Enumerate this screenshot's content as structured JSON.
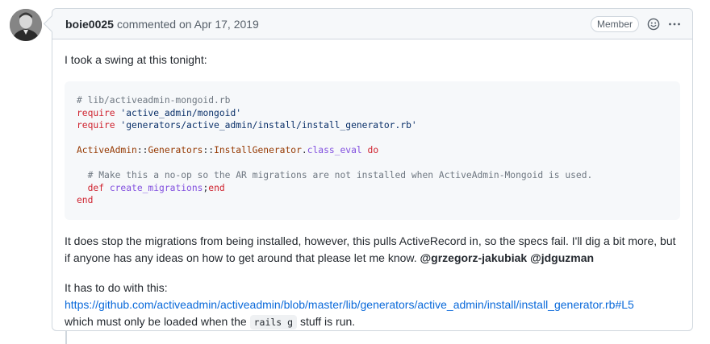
{
  "comment": {
    "author": "boie0025",
    "meta": "commented on Apr 17, 2019",
    "badge": "Member",
    "icons": {
      "reaction": "smiley-icon",
      "more": "kebab-horizontal-icon"
    },
    "avatar_icon": "user-avatar",
    "intro": "I took a swing at this tonight:",
    "code": {
      "l1": "# lib/activeadmin-mongoid.rb",
      "l2_kw": "require",
      "l2_str": "'active_admin/mongoid'",
      "l3_kw": "require",
      "l3_str": "'generators/active_admin/install/install_generator.rb'",
      "l5_c1": "ActiveAdmin",
      "l5_sep1": "::",
      "l5_c2": "Generators",
      "l5_sep2": "::",
      "l5_c3": "InstallGenerator",
      "l5_dot": ".",
      "l5_fn": "class_eval",
      "l5_kw": "do",
      "l7": "# Make this a no-op so the AR migrations are not installed when ActiveAdmin-Mongoid is used.",
      "l8_kw": "def",
      "l8_fn": "create_migrations",
      "l8_semi": ";",
      "l8_end": "end",
      "l9": "end"
    },
    "p2_text": "It does stop the migrations from being installed, however, this pulls ActiveRecord in, so the specs fail. I'll dig a bit more, but if anyone has any ideas on how to get around that please let me know.",
    "mention1": "@grzegorz-jakubiak",
    "mention2": "@jdguzman",
    "p3_intro": "It has to do with this:",
    "p3_link": "https://github.com/activeadmin/activeadmin/blob/master/lib/generators/active_admin/install/install_generator.rb#L5",
    "p3_pre": "which must only be loaded when the",
    "p3_code": "rails g",
    "p3_post": "stuff is run."
  }
}
